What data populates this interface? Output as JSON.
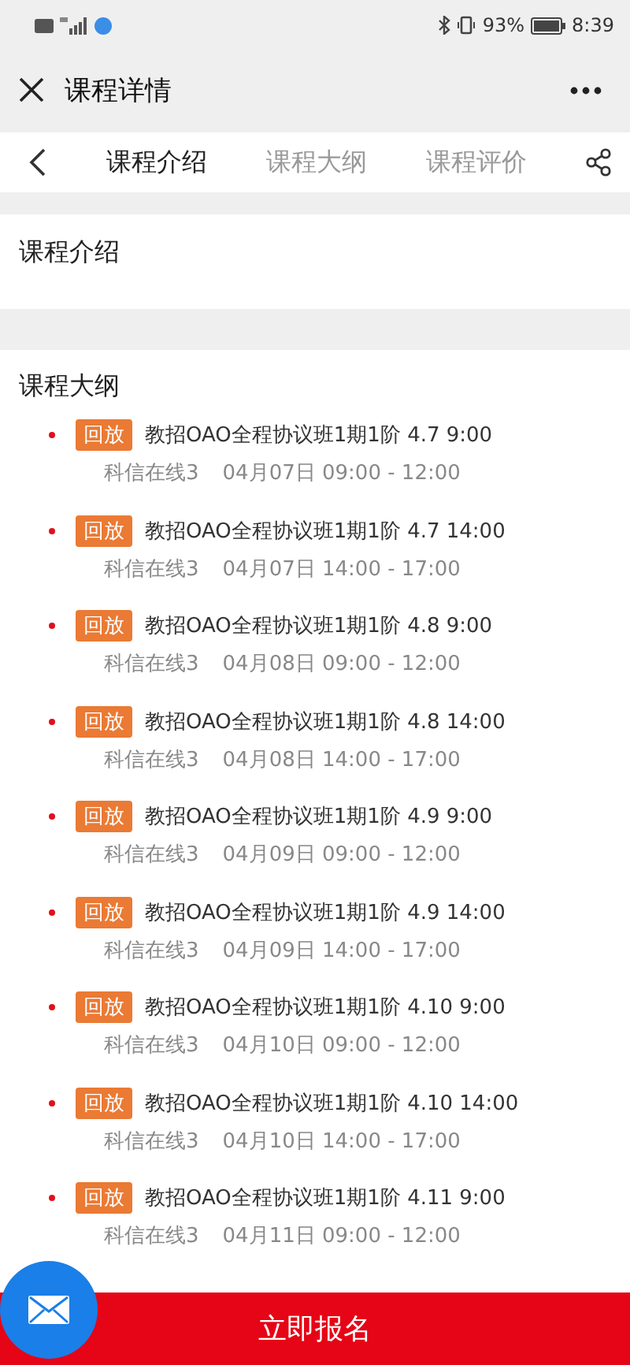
{
  "status_bar": {
    "battery": "93%",
    "time": "8:39"
  },
  "header": {
    "title": "课程详情"
  },
  "tabs": [
    {
      "label": "课程介绍",
      "selected": true
    },
    {
      "label": "课程大纲",
      "selected": false
    },
    {
      "label": "课程评价",
      "selected": false
    }
  ],
  "intro": {
    "heading": "课程介绍"
  },
  "outline": {
    "heading": "课程大纲",
    "lessons": [
      {
        "badge": "回放",
        "title": "教招OAO全程协议班1期1阶 4.7 9:00",
        "room": "科信在线3",
        "time": "04月07日 09:00 - 12:00"
      },
      {
        "badge": "回放",
        "title": "教招OAO全程协议班1期1阶 4.7 14:00",
        "room": "科信在线3",
        "time": "04月07日 14:00 - 17:00"
      },
      {
        "badge": "回放",
        "title": "教招OAO全程协议班1期1阶 4.8 9:00",
        "room": "科信在线3",
        "time": "04月08日 09:00 - 12:00"
      },
      {
        "badge": "回放",
        "title": "教招OAO全程协议班1期1阶 4.8 14:00",
        "room": "科信在线3",
        "time": "04月08日 14:00 - 17:00"
      },
      {
        "badge": "回放",
        "title": "教招OAO全程协议班1期1阶 4.9 9:00",
        "room": "科信在线3",
        "time": "04月09日 09:00 - 12:00"
      },
      {
        "badge": "回放",
        "title": "教招OAO全程协议班1期1阶 4.9 14:00",
        "room": "科信在线3",
        "time": "04月09日 14:00 - 17:00"
      },
      {
        "badge": "回放",
        "title": "教招OAO全程协议班1期1阶 4.10 9:00",
        "room": "科信在线3",
        "time": "04月10日 09:00 - 12:00"
      },
      {
        "badge": "回放",
        "title": "教招OAO全程协议班1期1阶 4.10 14:00",
        "room": "科信在线3",
        "time": "04月10日 14:00 - 17:00"
      },
      {
        "badge": "回放",
        "title": "教招OAO全程协议班1期1阶 4.11 9:00",
        "room": "科信在线3",
        "time": "04月11日 09:00 - 12:00"
      }
    ]
  },
  "footer": {
    "button": "立即报名"
  }
}
